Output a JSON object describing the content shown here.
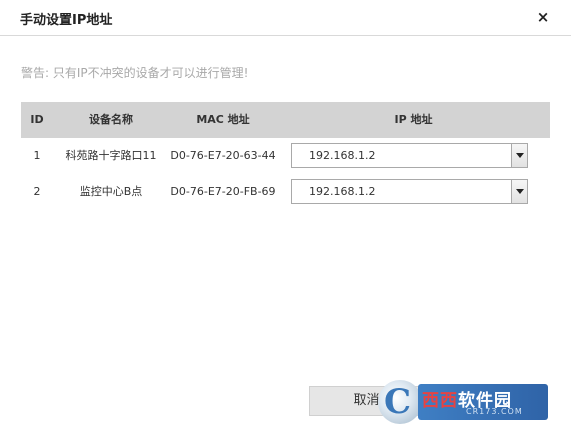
{
  "dialog": {
    "title": "手动设置IP地址",
    "close_symbol": "×",
    "warning": "警告: 只有IP不冲突的设备才可以进行管理!"
  },
  "table": {
    "headers": {
      "id": "ID",
      "name": "设备名称",
      "mac": "MAC 地址",
      "ip": "IP 地址"
    },
    "rows": [
      {
        "id": "1",
        "name": "科苑路十字路口11",
        "mac": "D0-76-E7-20-63-44",
        "ip": "192.168.1.2"
      },
      {
        "id": "2",
        "name": "监控中心B点",
        "mac": "D0-76-E7-20-FB-69",
        "ip": "192.168.1.2"
      }
    ]
  },
  "footer": {
    "cancel_label": "取消"
  },
  "watermark": {
    "letter": "C",
    "brand_white": "软件园",
    "brand_red": "西西",
    "domain": "CR173.COM"
  }
}
